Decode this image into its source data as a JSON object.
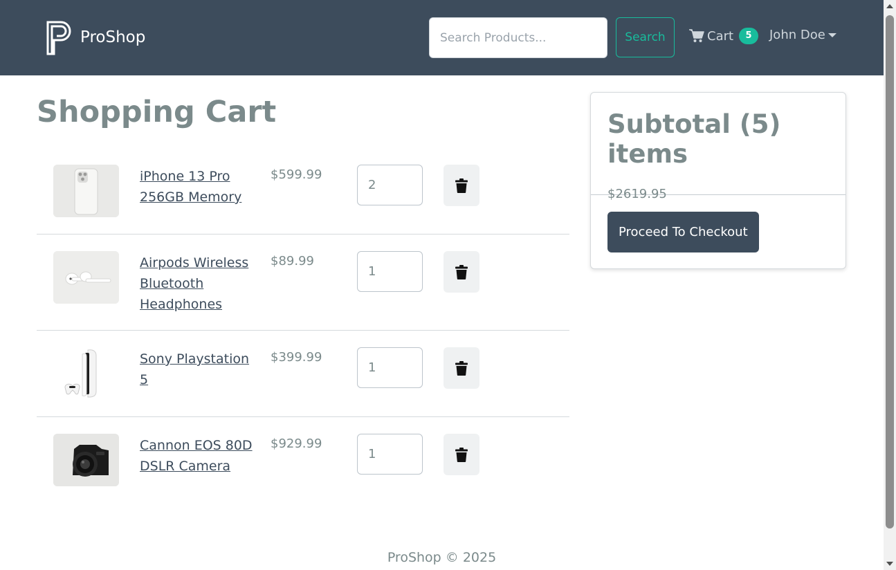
{
  "header": {
    "brand_name": "ProShop",
    "search_placeholder": "Search Products...",
    "search_label": "Search",
    "cart_label": "Cart",
    "cart_count": "5",
    "user_name": "John Doe"
  },
  "page": {
    "title": "Shopping Cart"
  },
  "cart": {
    "items": [
      {
        "name": "iPhone 13 Pro 256GB Memory",
        "price": "$599.99",
        "qty": "2",
        "image_icon": "iphone-icon"
      },
      {
        "name": "Airpods Wireless Bluetooth Headphones",
        "price": "$89.99",
        "qty": "1",
        "image_icon": "airpods-icon"
      },
      {
        "name": "Sony Playstation 5",
        "price": "$399.99",
        "qty": "1",
        "image_icon": "playstation-icon"
      },
      {
        "name": "Cannon EOS 80D DSLR Camera",
        "price": "$929.99",
        "qty": "1",
        "image_icon": "camera-icon"
      }
    ]
  },
  "summary": {
    "title": "Subtotal (5) items",
    "total": "$2619.95",
    "checkout_label": "Proceed To Checkout"
  },
  "footer": {
    "text": "ProShop © 2025"
  },
  "colors": {
    "navbar": "#3d4c5c",
    "accent": "#18bc9c",
    "text_muted": "#7b8a8b"
  }
}
